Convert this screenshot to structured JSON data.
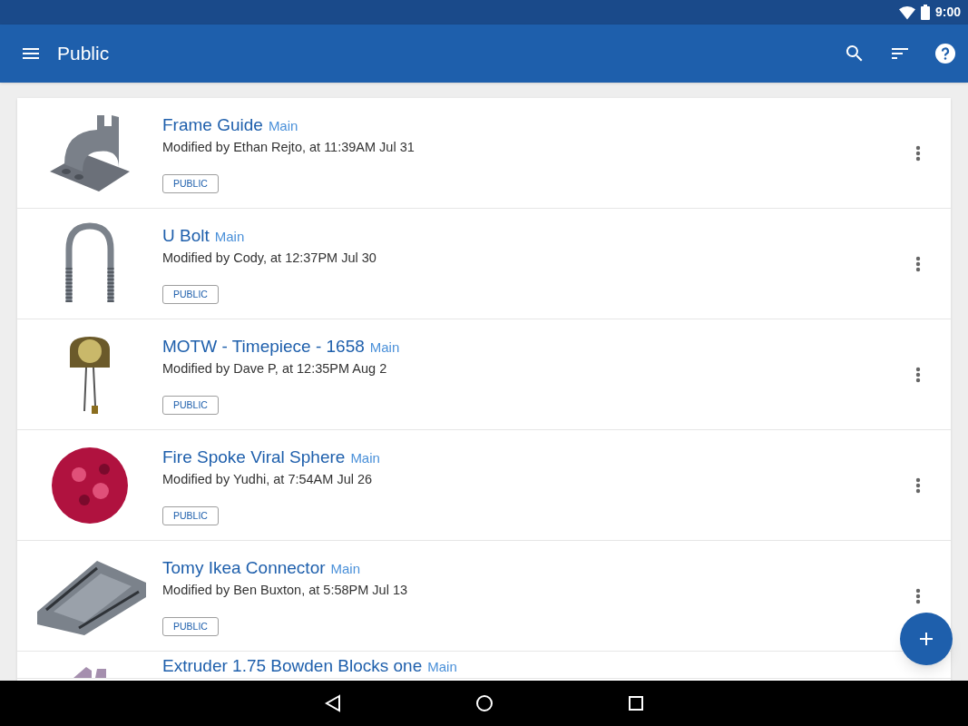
{
  "status_bar": {
    "time": "9:00"
  },
  "app_bar": {
    "title": "Public"
  },
  "documents": [
    {
      "kind": "bracket",
      "title": "Frame Guide",
      "branch": "Main",
      "modified": "Modified by Ethan Rejto, at 11:39AM Jul 31",
      "badge": "PUBLIC"
    },
    {
      "kind": "u-bolt",
      "title": "U Bolt",
      "branch": "Main",
      "modified": "Modified by Cody, at 12:37PM Jul 30",
      "badge": "PUBLIC"
    },
    {
      "kind": "clock",
      "title": "MOTW - Timepiece - 1658",
      "branch": "Main",
      "modified": "Modified by Dave P, at 12:35PM Aug 2",
      "badge": "PUBLIC"
    },
    {
      "kind": "sphere",
      "title": "Fire Spoke Viral Sphere",
      "branch": "Main",
      "modified": "Modified by Yudhi, at 7:54AM Jul 26",
      "badge": "PUBLIC"
    },
    {
      "kind": "connector",
      "title": "Tomy Ikea Connector",
      "branch": "Main",
      "modified": "Modified by Ben Buxton, at 5:58PM Jul 13",
      "badge": "PUBLIC"
    },
    {
      "kind": "extruder",
      "title": "Extruder 1.75 Bowden Blocks one",
      "branch": "Main"
    }
  ]
}
